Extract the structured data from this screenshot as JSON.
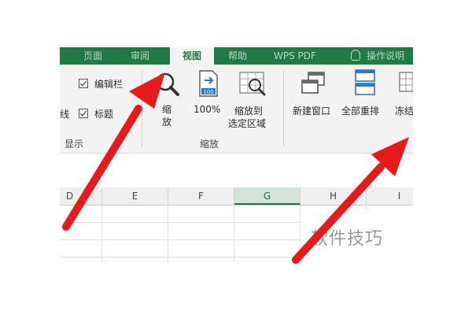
{
  "ribbon": {
    "tabs_partial": [
      "页面",
      "审阅",
      "视图",
      "帮助",
      "WPS PDF",
      "操作说明"
    ],
    "show_group": {
      "formula_bar_label": "编辑栏",
      "gridlines_partial_label": "线",
      "headings_label": "标题",
      "group_label": "显示"
    },
    "zoom_group": {
      "zoom_label_line1": "缩",
      "zoom_label_line2": "放",
      "zoom100_label": "100%",
      "zoom100_icon_text": "100",
      "zoom_selection_line1": "缩放到",
      "zoom_selection_line2": "选定区域",
      "group_label": "缩放"
    },
    "window_group": {
      "new_window_label": "新建窗口",
      "arrange_all_label": "全部重排",
      "freeze_partial_label": "冻结"
    }
  },
  "grid": {
    "columns": [
      "D",
      "E",
      "F",
      "G",
      "H",
      "I"
    ],
    "selected_column": "G"
  },
  "watermark": "软件技巧",
  "colors": {
    "excel_green": "#1f7a45",
    "arrow_red": "#e8191b",
    "ribbon_bg": "#f3f3f3"
  }
}
